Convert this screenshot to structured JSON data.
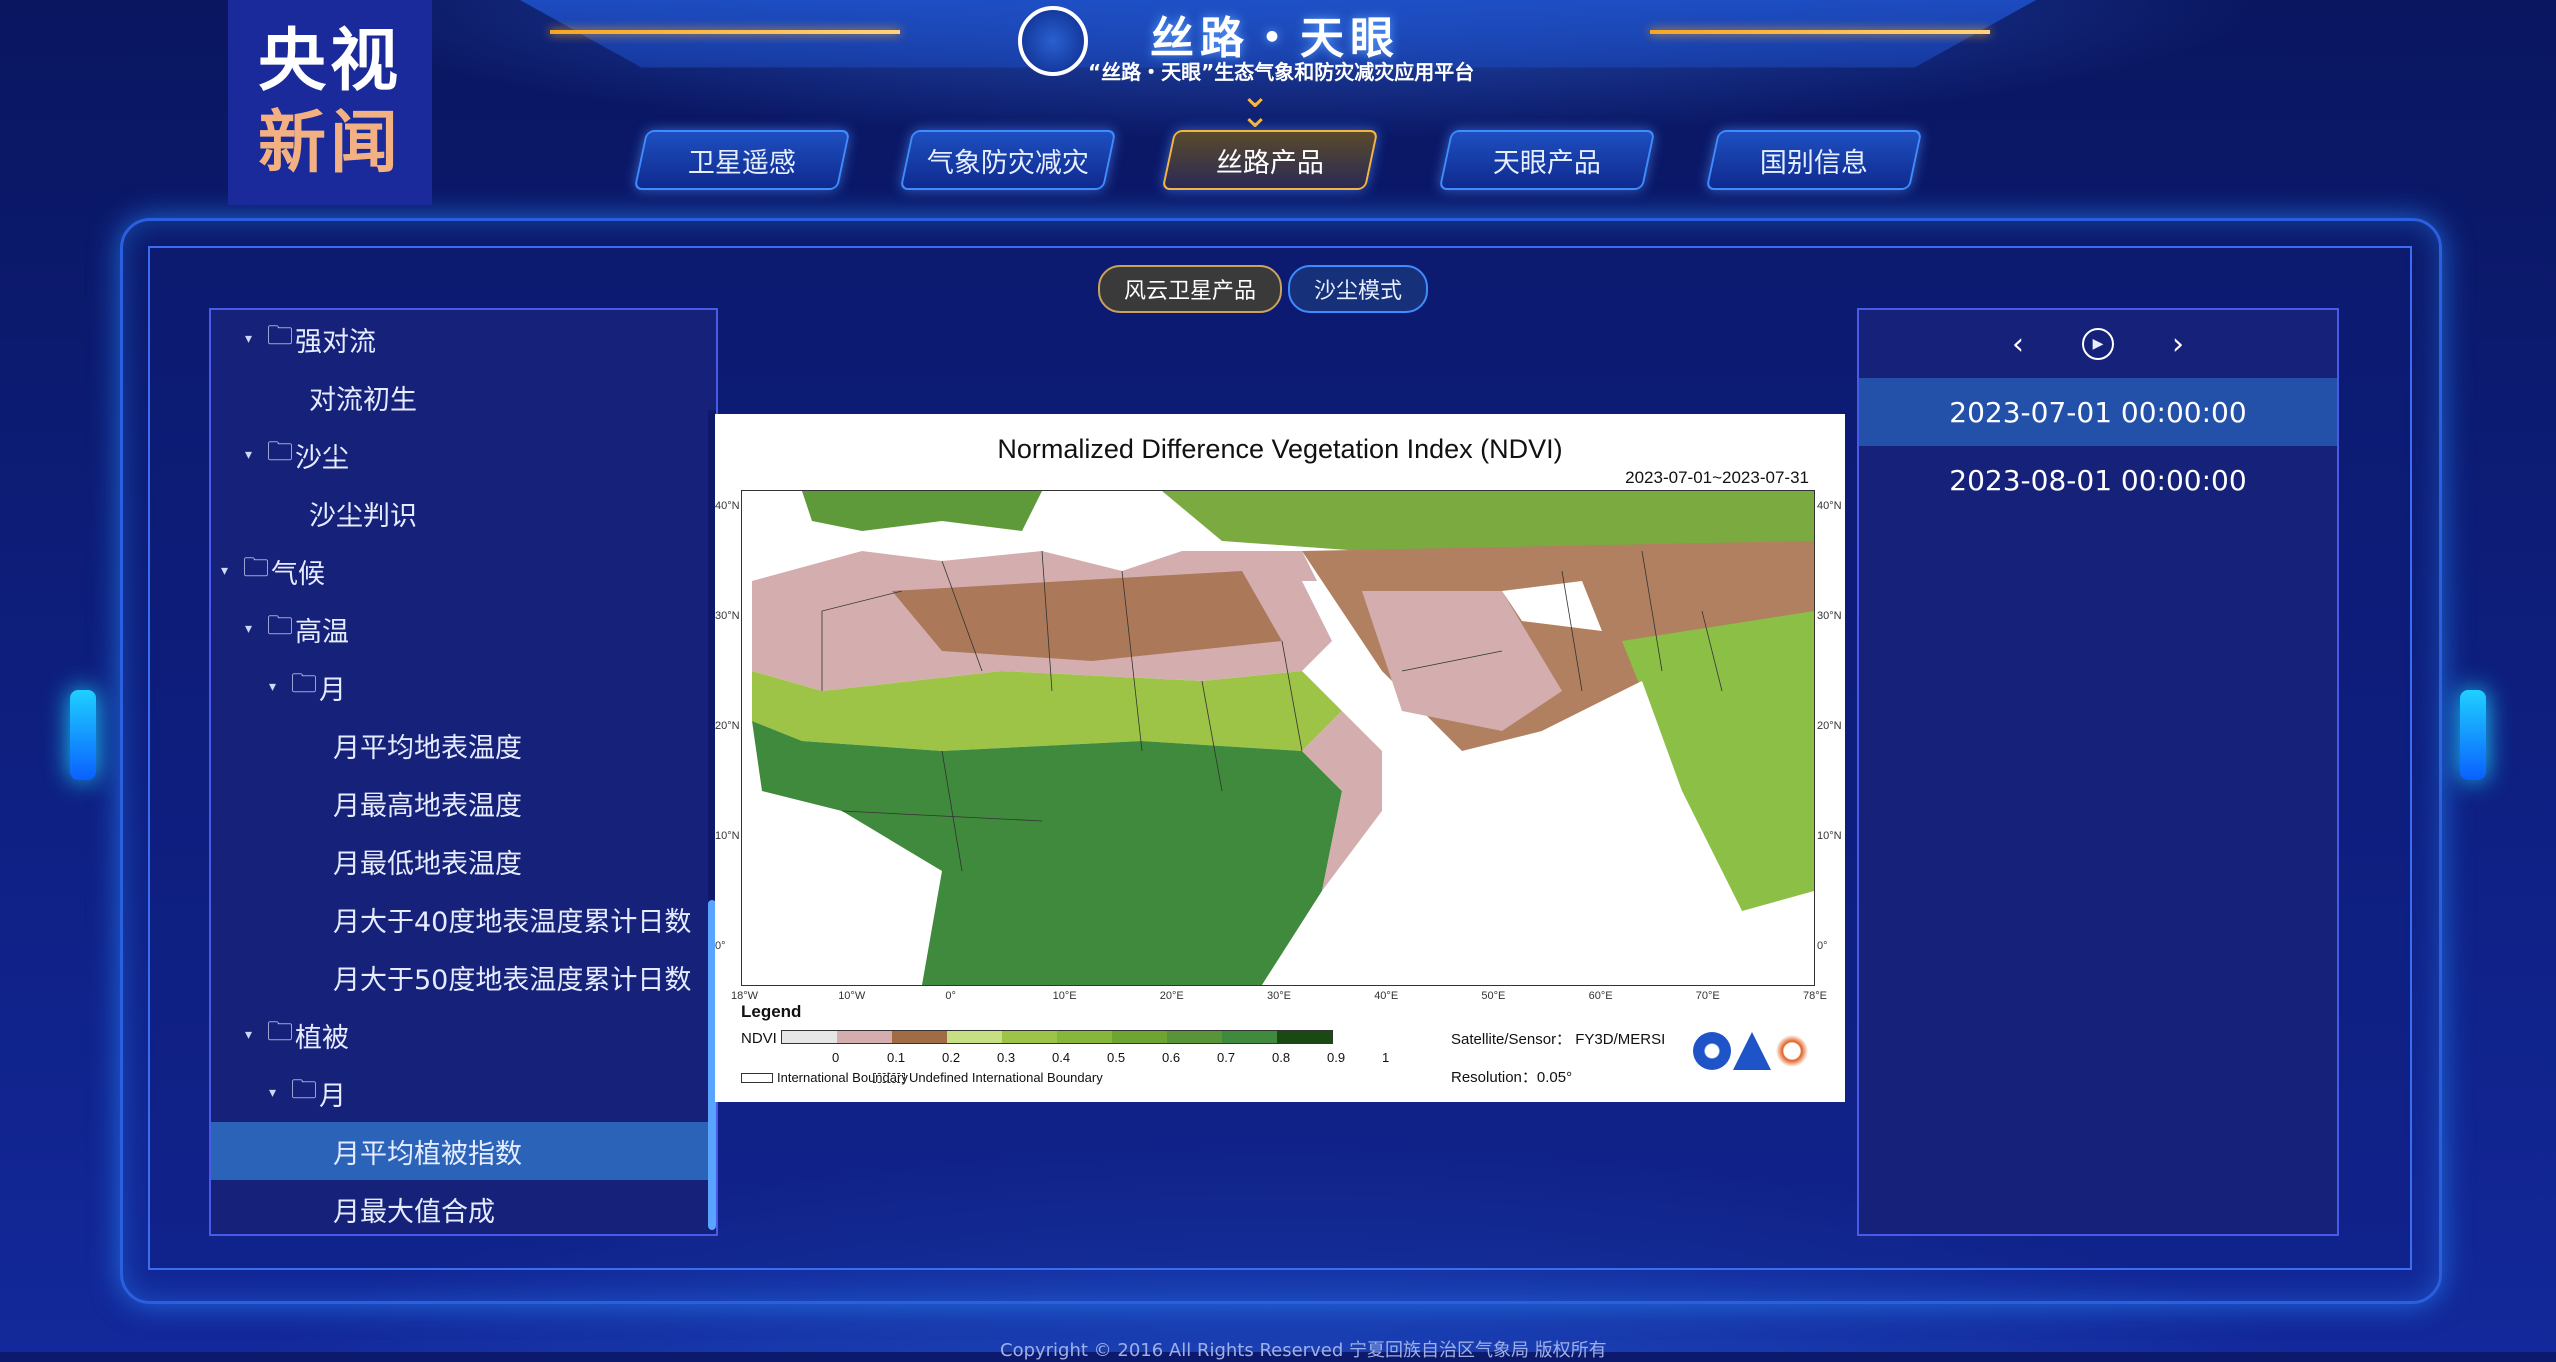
{
  "header": {
    "title": "丝路・天眼",
    "subtitle": "“丝路・天眼”生态气象和防灾减灾应用平台",
    "watermark": {
      "line1": "央视",
      "line2": "新闻"
    }
  },
  "nav": [
    {
      "label": "卫星遥感",
      "active": false
    },
    {
      "label": "气象防灾减灾",
      "active": false
    },
    {
      "label": "丝路产品",
      "active": true
    },
    {
      "label": "天眼产品",
      "active": false
    },
    {
      "label": "国别信息",
      "active": false
    }
  ],
  "subtabs": [
    {
      "label": "风云卫星产品",
      "active": true
    },
    {
      "label": "沙尘模式",
      "active": false
    }
  ],
  "tree": [
    {
      "label": "强对流",
      "indent": 1,
      "folder": true,
      "expanded": true,
      "selected": false
    },
    {
      "label": "对流初生",
      "indent": 2,
      "folder": false,
      "expanded": false,
      "selected": false
    },
    {
      "label": "沙尘",
      "indent": 1,
      "folder": true,
      "expanded": true,
      "selected": false
    },
    {
      "label": "沙尘判识",
      "indent": 2,
      "folder": false,
      "expanded": false,
      "selected": false
    },
    {
      "label": "气候",
      "indent": 0,
      "folder": true,
      "expanded": true,
      "selected": false
    },
    {
      "label": "高温",
      "indent": 1,
      "folder": true,
      "expanded": true,
      "selected": false
    },
    {
      "label": "月",
      "indent": 2,
      "folder": true,
      "expanded": true,
      "selected": false
    },
    {
      "label": "月平均地表温度",
      "indent": 3,
      "folder": false,
      "expanded": false,
      "selected": false
    },
    {
      "label": "月最高地表温度",
      "indent": 3,
      "folder": false,
      "expanded": false,
      "selected": false
    },
    {
      "label": "月最低地表温度",
      "indent": 3,
      "folder": false,
      "expanded": false,
      "selected": false
    },
    {
      "label": "月大于40度地表温度累计日数",
      "indent": 3,
      "folder": false,
      "expanded": false,
      "selected": false
    },
    {
      "label": "月大于50度地表温度累计日数",
      "indent": 3,
      "folder": false,
      "expanded": false,
      "selected": false
    },
    {
      "label": "植被",
      "indent": 1,
      "folder": true,
      "expanded": true,
      "selected": false
    },
    {
      "label": "月",
      "indent": 2,
      "folder": true,
      "expanded": true,
      "selected": false
    },
    {
      "label": "月平均植被指数",
      "indent": 3,
      "folder": false,
      "expanded": false,
      "selected": true
    },
    {
      "label": "月最大值合成",
      "indent": 3,
      "folder": false,
      "expanded": false,
      "selected": false
    }
  ],
  "map": {
    "title": "Normalized Difference Vegetation Index (NDVI)",
    "date_range": "2023-07-01~2023-07-31",
    "lon_ticks": [
      "18°W",
      "10°W",
      "0°",
      "10°E",
      "20°E",
      "30°E",
      "40°E",
      "50°E",
      "60°E",
      "70°E",
      "78°E"
    ],
    "lat_ticks": [
      "40°N",
      "30°N",
      "20°N",
      "10°N",
      "0°"
    ],
    "legend_title": "Legend",
    "legend_label": "NDVI",
    "legend_colors": [
      "#e6e6e6",
      "#d4aeae",
      "#a06c45",
      "#c6df82",
      "#9ec447",
      "#86b63a",
      "#6ea532",
      "#5a9438",
      "#3f8a3c",
      "#184a12"
    ],
    "legend_values": [
      "0",
      "0.1",
      "0.2",
      "0.3",
      "0.4",
      "0.5",
      "0.6",
      "0.7",
      "0.8",
      "0.9",
      "1"
    ],
    "boundary_intl": "International Boundary",
    "boundary_undef": "Undefined International Boundary",
    "sensor": "Satellite/Sensor：   FY3D/MERSI",
    "resolution": "Resolution：0.05°",
    "logos": [
      "CMA",
      "NSMC",
      "NCSH"
    ]
  },
  "times": {
    "prev_icon": "chevron-left-icon",
    "play_icon": "play-circle-icon",
    "next_icon": "chevron-right-icon",
    "items": [
      {
        "label": "2023-07-01 00:00:00",
        "active": true
      },
      {
        "label": "2023-08-01 00:00:00",
        "active": false
      }
    ]
  },
  "footer": "Copyright © 2016 All Rights Reserved 宁夏回族自治区气象局 版权所有"
}
